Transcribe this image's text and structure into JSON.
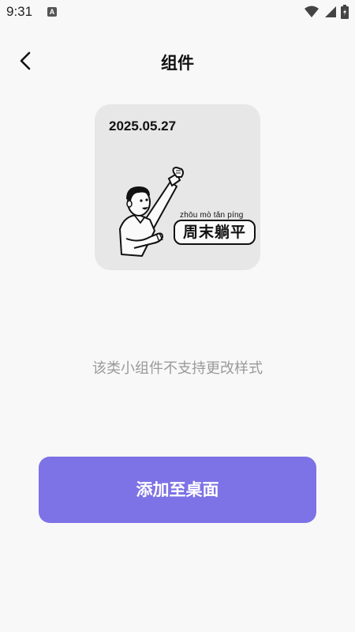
{
  "status_bar": {
    "time": "9:31",
    "notification_letter": "A",
    "icons": [
      "wifi-icon",
      "signal-icon",
      "battery-icon"
    ]
  },
  "header": {
    "title": "组件",
    "back_icon": "chevron-left-icon"
  },
  "widget": {
    "date": "2025.05.27",
    "pinyin": "zhōu mò tǎn píng",
    "slogan": "周末躺平"
  },
  "hint": "该类小组件不支持更改样式",
  "add_button_label": "添加至桌面",
  "colors": {
    "background": "#f8f8f8",
    "card": "#e7e7e7",
    "accent": "#7d72e6",
    "hint": "#9a9a9a"
  }
}
